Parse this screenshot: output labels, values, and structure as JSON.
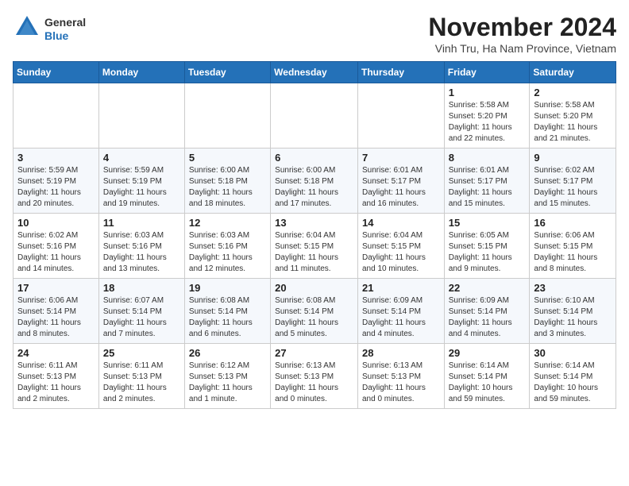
{
  "header": {
    "logo_line1": "General",
    "logo_line2": "Blue",
    "month_title": "November 2024",
    "location": "Vinh Tru, Ha Nam Province, Vietnam"
  },
  "weekdays": [
    "Sunday",
    "Monday",
    "Tuesday",
    "Wednesday",
    "Thursday",
    "Friday",
    "Saturday"
  ],
  "weeks": [
    [
      {
        "day": "",
        "info": ""
      },
      {
        "day": "",
        "info": ""
      },
      {
        "day": "",
        "info": ""
      },
      {
        "day": "",
        "info": ""
      },
      {
        "day": "",
        "info": ""
      },
      {
        "day": "1",
        "info": "Sunrise: 5:58 AM\nSunset: 5:20 PM\nDaylight: 11 hours\nand 22 minutes."
      },
      {
        "day": "2",
        "info": "Sunrise: 5:58 AM\nSunset: 5:20 PM\nDaylight: 11 hours\nand 21 minutes."
      }
    ],
    [
      {
        "day": "3",
        "info": "Sunrise: 5:59 AM\nSunset: 5:19 PM\nDaylight: 11 hours\nand 20 minutes."
      },
      {
        "day": "4",
        "info": "Sunrise: 5:59 AM\nSunset: 5:19 PM\nDaylight: 11 hours\nand 19 minutes."
      },
      {
        "day": "5",
        "info": "Sunrise: 6:00 AM\nSunset: 5:18 PM\nDaylight: 11 hours\nand 18 minutes."
      },
      {
        "day": "6",
        "info": "Sunrise: 6:00 AM\nSunset: 5:18 PM\nDaylight: 11 hours\nand 17 minutes."
      },
      {
        "day": "7",
        "info": "Sunrise: 6:01 AM\nSunset: 5:17 PM\nDaylight: 11 hours\nand 16 minutes."
      },
      {
        "day": "8",
        "info": "Sunrise: 6:01 AM\nSunset: 5:17 PM\nDaylight: 11 hours\nand 15 minutes."
      },
      {
        "day": "9",
        "info": "Sunrise: 6:02 AM\nSunset: 5:17 PM\nDaylight: 11 hours\nand 15 minutes."
      }
    ],
    [
      {
        "day": "10",
        "info": "Sunrise: 6:02 AM\nSunset: 5:16 PM\nDaylight: 11 hours\nand 14 minutes."
      },
      {
        "day": "11",
        "info": "Sunrise: 6:03 AM\nSunset: 5:16 PM\nDaylight: 11 hours\nand 13 minutes."
      },
      {
        "day": "12",
        "info": "Sunrise: 6:03 AM\nSunset: 5:16 PM\nDaylight: 11 hours\nand 12 minutes."
      },
      {
        "day": "13",
        "info": "Sunrise: 6:04 AM\nSunset: 5:15 PM\nDaylight: 11 hours\nand 11 minutes."
      },
      {
        "day": "14",
        "info": "Sunrise: 6:04 AM\nSunset: 5:15 PM\nDaylight: 11 hours\nand 10 minutes."
      },
      {
        "day": "15",
        "info": "Sunrise: 6:05 AM\nSunset: 5:15 PM\nDaylight: 11 hours\nand 9 minutes."
      },
      {
        "day": "16",
        "info": "Sunrise: 6:06 AM\nSunset: 5:15 PM\nDaylight: 11 hours\nand 8 minutes."
      }
    ],
    [
      {
        "day": "17",
        "info": "Sunrise: 6:06 AM\nSunset: 5:14 PM\nDaylight: 11 hours\nand 8 minutes."
      },
      {
        "day": "18",
        "info": "Sunrise: 6:07 AM\nSunset: 5:14 PM\nDaylight: 11 hours\nand 7 minutes."
      },
      {
        "day": "19",
        "info": "Sunrise: 6:08 AM\nSunset: 5:14 PM\nDaylight: 11 hours\nand 6 minutes."
      },
      {
        "day": "20",
        "info": "Sunrise: 6:08 AM\nSunset: 5:14 PM\nDaylight: 11 hours\nand 5 minutes."
      },
      {
        "day": "21",
        "info": "Sunrise: 6:09 AM\nSunset: 5:14 PM\nDaylight: 11 hours\nand 4 minutes."
      },
      {
        "day": "22",
        "info": "Sunrise: 6:09 AM\nSunset: 5:14 PM\nDaylight: 11 hours\nand 4 minutes."
      },
      {
        "day": "23",
        "info": "Sunrise: 6:10 AM\nSunset: 5:14 PM\nDaylight: 11 hours\nand 3 minutes."
      }
    ],
    [
      {
        "day": "24",
        "info": "Sunrise: 6:11 AM\nSunset: 5:13 PM\nDaylight: 11 hours\nand 2 minutes."
      },
      {
        "day": "25",
        "info": "Sunrise: 6:11 AM\nSunset: 5:13 PM\nDaylight: 11 hours\nand 2 minutes."
      },
      {
        "day": "26",
        "info": "Sunrise: 6:12 AM\nSunset: 5:13 PM\nDaylight: 11 hours\nand 1 minute."
      },
      {
        "day": "27",
        "info": "Sunrise: 6:13 AM\nSunset: 5:13 PM\nDaylight: 11 hours\nand 0 minutes."
      },
      {
        "day": "28",
        "info": "Sunrise: 6:13 AM\nSunset: 5:13 PM\nDaylight: 11 hours\nand 0 minutes."
      },
      {
        "day": "29",
        "info": "Sunrise: 6:14 AM\nSunset: 5:14 PM\nDaylight: 10 hours\nand 59 minutes."
      },
      {
        "day": "30",
        "info": "Sunrise: 6:14 AM\nSunset: 5:14 PM\nDaylight: 10 hours\nand 59 minutes."
      }
    ]
  ]
}
